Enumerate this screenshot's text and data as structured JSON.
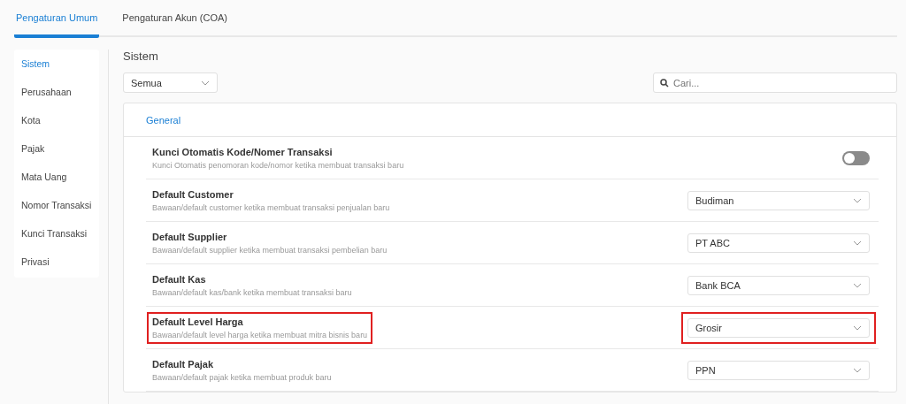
{
  "tabs": [
    {
      "label": "Pengaturan Umum",
      "selected": true
    },
    {
      "label": "Pengaturan Akun (COA)",
      "selected": false
    }
  ],
  "sidebar": {
    "items": [
      {
        "label": "Sistem",
        "selected": true
      },
      {
        "label": "Perusahaan",
        "selected": false
      },
      {
        "label": "Kota",
        "selected": false
      },
      {
        "label": "Pajak",
        "selected": false
      },
      {
        "label": "Mata Uang",
        "selected": false
      },
      {
        "label": "Nomor Transaksi",
        "selected": false
      },
      {
        "label": "Kunci Transaksi",
        "selected": false
      },
      {
        "label": "Privasi",
        "selected": false
      }
    ]
  },
  "section_title": "Sistem",
  "filter": {
    "value": "Semua"
  },
  "search": {
    "placeholder": "Cari..."
  },
  "card": {
    "header": "General",
    "settings": [
      {
        "kind": "toggle",
        "title": "Kunci Otomatis Kode/Nomer Transaksi",
        "description": "Kunci Otomatis penomoran kode/nomor ketika membuat transaksi baru",
        "on": false,
        "highlighted": false
      },
      {
        "kind": "select",
        "title": "Default Customer",
        "description": "Bawaan/default customer ketika membuat transaksi penjualan baru",
        "value": "Budiman",
        "highlighted": false
      },
      {
        "kind": "select",
        "title": "Default Supplier",
        "description": "Bawaan/default supplier ketika membuat transaksi pembelian baru",
        "value": "PT ABC",
        "highlighted": false
      },
      {
        "kind": "select",
        "title": "Default Kas",
        "description": "Bawaan/default kas/bank ketika membuat transaksi baru",
        "value": "Bank BCA",
        "highlighted": false
      },
      {
        "kind": "select",
        "title": "Default Level Harga",
        "description": "Bawaan/default level harga ketika membuat mitra bisnis baru",
        "value": "Grosir",
        "highlighted": true
      },
      {
        "kind": "select",
        "title": "Default Pajak",
        "description": "Bawaan/default pajak ketika membuat produk baru",
        "value": "PPN",
        "highlighted": false
      }
    ]
  }
}
